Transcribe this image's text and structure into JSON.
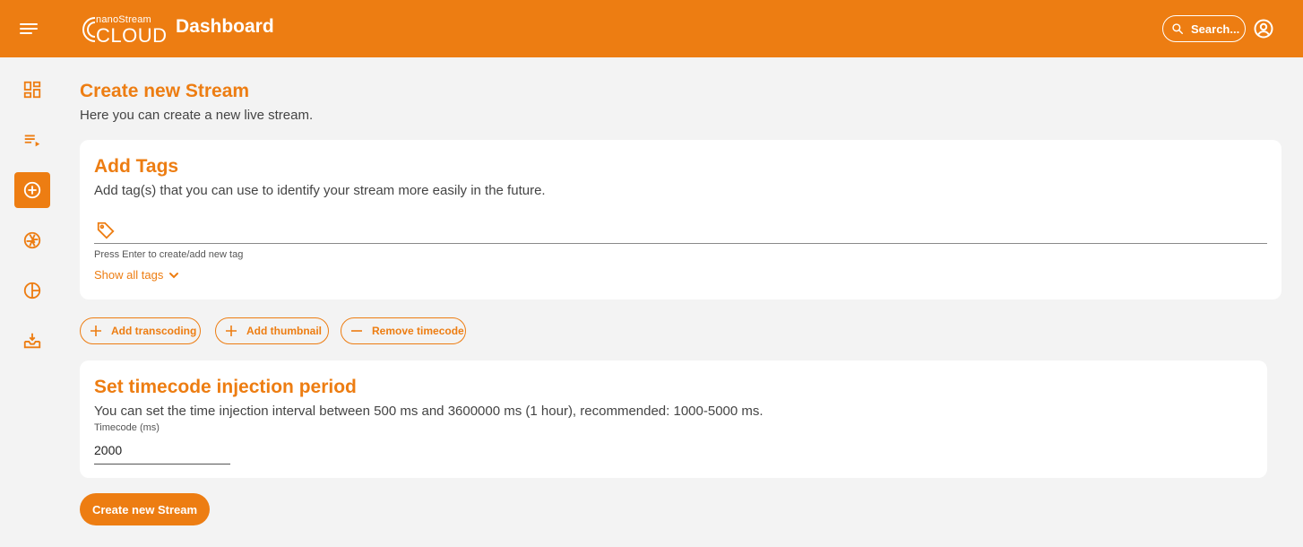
{
  "header": {
    "logo_small": "nanoStream",
    "logo_big": "CLOUD",
    "title": "Dashboard",
    "search_label": "Search...",
    "brand_color": "#ed7d12"
  },
  "sidebar": {
    "items": [
      {
        "icon": "dashboard-icon",
        "active": false
      },
      {
        "icon": "playlist-play-icon",
        "active": false
      },
      {
        "icon": "add-circle-icon",
        "active": true
      },
      {
        "icon": "shutter-icon",
        "active": false
      },
      {
        "icon": "analytics-pie-icon",
        "active": false
      },
      {
        "icon": "inbox-download-icon",
        "active": false
      }
    ]
  },
  "page": {
    "title": "Create new Stream",
    "subtitle": "Here you can create a new live stream."
  },
  "tags_card": {
    "title": "Add Tags",
    "description": "Add tag(s) that you can use to identify your stream more easily in the future.",
    "input_value": "",
    "hint": "Press Enter to create/add new tag",
    "show_all_label": "Show all tags"
  },
  "actions": {
    "add_transcoding": "Add transcoding",
    "add_thumbnail": "Add thumbnail",
    "remove_timecode": "Remove timecode"
  },
  "timecode_card": {
    "title": "Set timecode injection period",
    "description": "You can set the time injection interval between 500 ms and 3600000 ms (1 hour), recommended: 1000-5000 ms.",
    "field_label": "Timecode (ms)",
    "field_value": "2000"
  },
  "submit": {
    "label": "Create new Stream"
  }
}
